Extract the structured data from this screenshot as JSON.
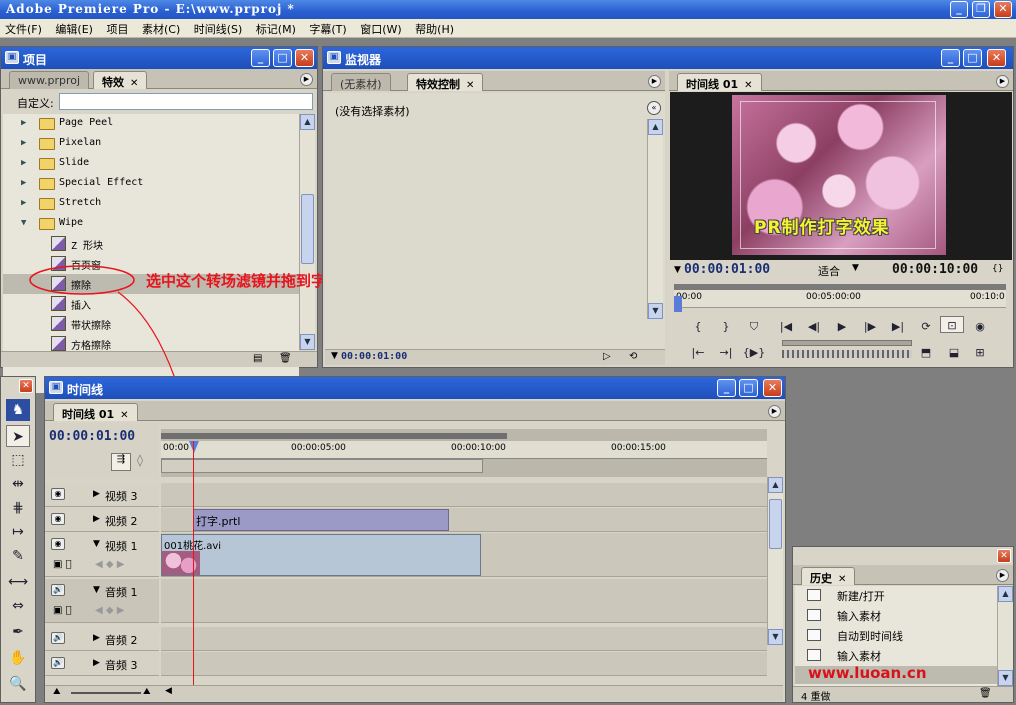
{
  "app": {
    "title": "Adobe Premiere Pro - E:\\www.prproj *",
    "controls": [
      "_",
      "❐",
      "✕"
    ]
  },
  "menu": [
    "文件(F)",
    "编辑(E)",
    "项目",
    "素材(C)",
    "时间线(S)",
    "标记(M)",
    "字幕(T)",
    "窗口(W)",
    "帮助(H)"
  ],
  "project_panel": {
    "title": "项目",
    "tabs": [
      "www.prproj",
      "特效"
    ],
    "custom_label": "自定义:",
    "custom_value": "",
    "tree": [
      {
        "type": "folder",
        "label": "Page Peel",
        "expanded": false
      },
      {
        "type": "folder",
        "label": "Pixelan",
        "expanded": false
      },
      {
        "type": "folder",
        "label": "Slide",
        "expanded": false
      },
      {
        "type": "folder",
        "label": "Special Effect",
        "expanded": false
      },
      {
        "type": "folder",
        "label": "Stretch",
        "expanded": false
      },
      {
        "type": "folder",
        "label": "Wipe",
        "expanded": true
      },
      {
        "type": "effect",
        "label": "Z 形块"
      },
      {
        "type": "effect",
        "label": "百页窗"
      },
      {
        "type": "effect",
        "label": "擦除",
        "selected": true
      },
      {
        "type": "effect",
        "label": "插入"
      },
      {
        "type": "effect",
        "label": "带状擦除"
      },
      {
        "type": "effect",
        "label": "方格擦除"
      }
    ]
  },
  "annotation": "选中这个转场滤镜并拖到字幕上",
  "effect_panel": {
    "title": "监视器",
    "tabs": [
      "(无素材)",
      "特效控制"
    ],
    "message": "(没有选择素材)",
    "timecode": "00:00:01:00"
  },
  "program_monitor": {
    "tab": "时间线 01",
    "video_text": "PR制作打字效果",
    "current_time": "00:00:01:00",
    "fit_label": "适合",
    "duration": "00:00:10:00",
    "ruler": [
      "00:00",
      "00:05:00:00",
      "00:10:0"
    ]
  },
  "timeline": {
    "title": "时间线",
    "tab": "时间线 01",
    "current_time": "00:00:01:00",
    "ruler": [
      "00:00",
      "00:00:05:00",
      "00:00:10:00",
      "00:00:15:00"
    ],
    "tracks": [
      {
        "name": "视频 3",
        "kind": "video"
      },
      {
        "name": "视频 2",
        "kind": "video",
        "clip": "打字.prtl"
      },
      {
        "name": "视频 1",
        "kind": "video",
        "clip": "001桃花.avi"
      },
      {
        "name": "音频 1",
        "kind": "audio"
      },
      {
        "name": "音频 2",
        "kind": "audio"
      },
      {
        "name": "音频 3",
        "kind": "audio"
      }
    ]
  },
  "history": {
    "tab": "历史",
    "items": [
      "新建/打开",
      "输入素材",
      "自动到时间线",
      "输入素材"
    ],
    "footer": "4 重做"
  },
  "watermark": "www.luoan.cn"
}
